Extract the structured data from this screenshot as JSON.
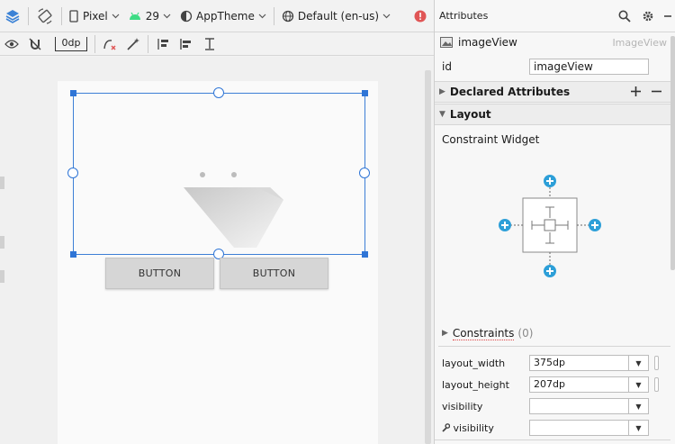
{
  "toolbar": {
    "device": "Pixel",
    "api_level": "29",
    "theme": "AppTheme",
    "locale": "Default (en-us)",
    "default_margin": "0dp"
  },
  "canvas": {
    "buttons": [
      {
        "label": "BUTTON"
      },
      {
        "label": "BUTTON"
      }
    ]
  },
  "attributes": {
    "title": "Attributes",
    "widget_name": "imageView",
    "widget_type": "ImageView",
    "id_label": "id",
    "id_value": "imageView",
    "declared_attributes": "Declared Attributes",
    "layout_section": "Layout",
    "constraint_widget": "Constraint Widget",
    "constraints_label": "Constraints",
    "constraints_count": "(0)",
    "props": [
      {
        "label": "layout_width",
        "value": "375dp"
      },
      {
        "label": "layout_height",
        "value": "207dp"
      },
      {
        "label": "visibility",
        "value": ""
      },
      {
        "label": "visibility",
        "value": ""
      }
    ]
  },
  "colors": {
    "selection_blue": "#2f75d6",
    "constraint_plus": "#2d9fd8",
    "error_red": "#e05555",
    "android_green": "#3ddc84"
  }
}
